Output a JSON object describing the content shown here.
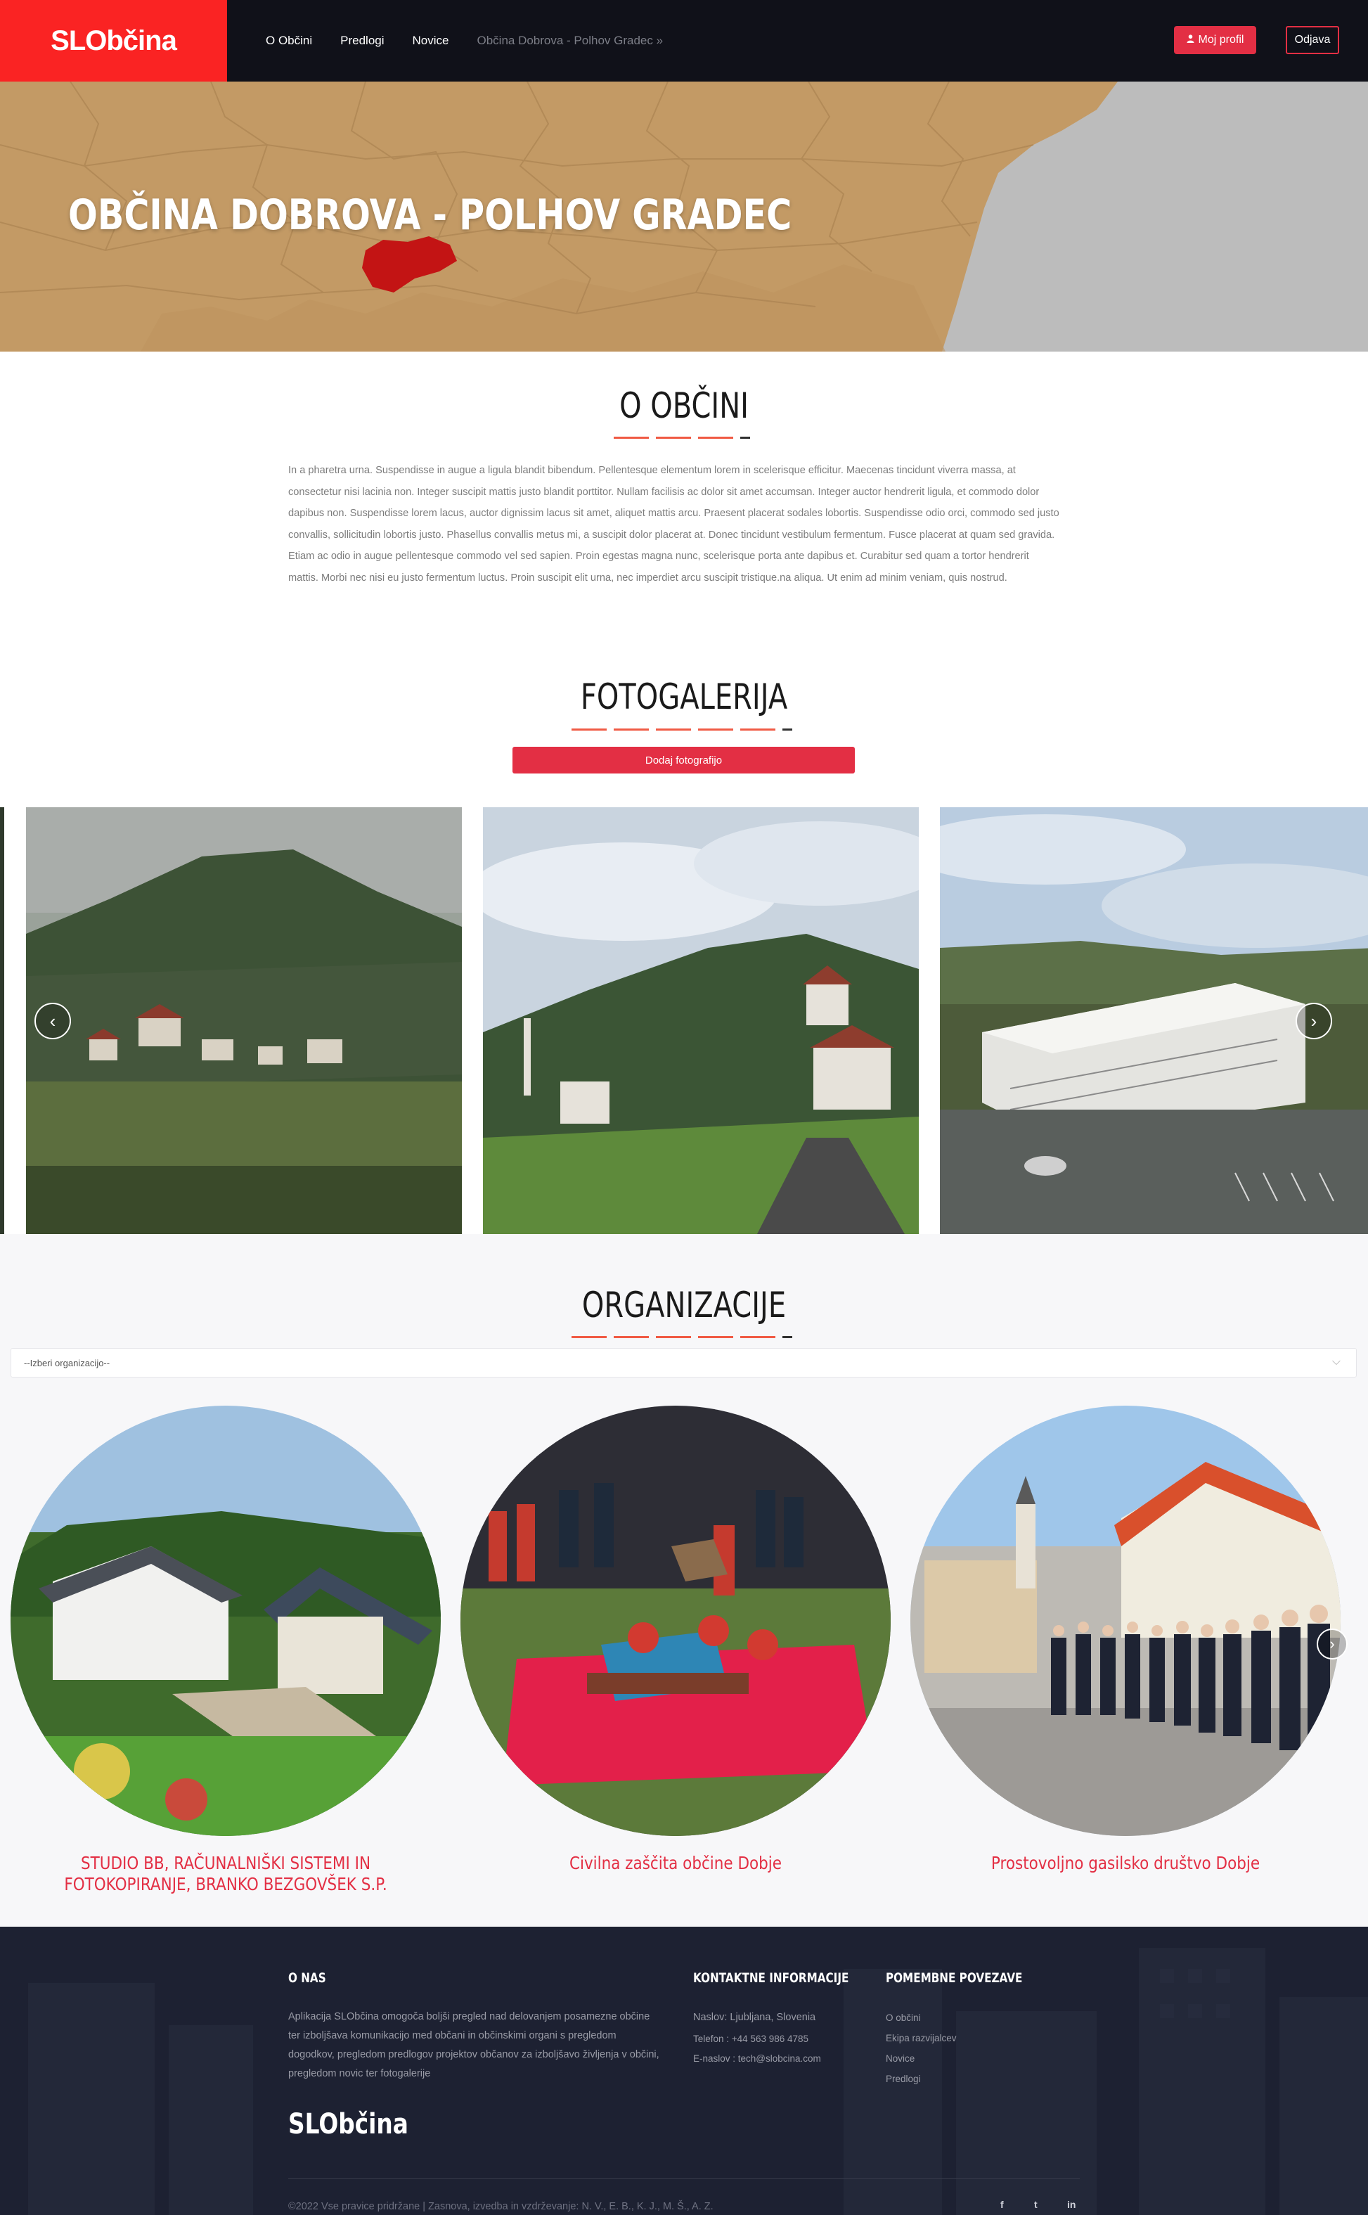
{
  "nav": {
    "brand": "SLObčina",
    "links": [
      "O Občini",
      "Predlogi",
      "Novice"
    ],
    "breadcrumb": "Občina Dobrova - Polhov Gradec »",
    "profile_label": "Moj profil",
    "logout_label": "Odjava"
  },
  "hero": {
    "title": "OBČINA DOBROVA - POLHOV GRADEC"
  },
  "about": {
    "title": "O OBČINI",
    "text": "In a pharetra urna. Suspendisse in augue a ligula blandit bibendum. Pellentesque elementum lorem in scelerisque efficitur. Maecenas tincidunt viverra massa, at consectetur nisi lacinia non. Integer suscipit mattis justo blandit porttitor. Nullam facilisis ac dolor sit amet accumsan. Integer auctor hendrerit ligula, et commodo dolor dapibus non. Suspendisse lorem lacus, auctor dignissim lacus sit amet, aliquet mattis arcu. Praesent placerat sodales lobortis. Suspendisse odio orci, commodo sed justo convallis, sollicitudin lobortis justo. Phasellus convallis metus mi, a suscipit dolor placerat at. Donec tincidunt vestibulum fermentum. Fusce placerat at quam sed gravida. Etiam ac odio in augue pellentesque commodo vel sed sapien. Proin egestas magna nunc, scelerisque porta ante dapibus et. Curabitur sed quam a tortor hendrerit mattis. Morbi nec nisi eu justo fermentum luctus. Proin suscipit elit urna, nec imperdiet arcu suscipit tristique.na aliqua. Ut enim ad minim veniam, quis nostrud."
  },
  "gallery": {
    "title": "FOTOGALERIJA",
    "add_button": "Dodaj fotografijo",
    "prev_icon": "‹",
    "next_icon": "›"
  },
  "organizations": {
    "title": "ORGANIZACIJE",
    "select_value": "--Izberi organizacijo--",
    "items": [
      {
        "name": "STUDIO BB, RAČUNALNIŠKI SISTEMI IN FOTOKOPIRANJE, BRANKO BEZGOVŠEK S.P."
      },
      {
        "name": "Civilna zaščita občine Dobje"
      },
      {
        "name": "Prostovoljno gasilsko društvo Dobje"
      }
    ]
  },
  "footer": {
    "about_title": "O NAS",
    "about_text": "Aplikacija SLObčina omogoča boljši pregled nad delovanjem posamezne občine ter izboljšava komunikacijo med občani in občinskimi organi s pregledom dogodkov, pregledom predlogov projektov občanov za izboljšavo življenja v občini, pregledom novic ter fotogalerije",
    "contact_title": "KONTAKTNE INFORMACIJE",
    "contact_address": "Naslov: Ljubljana, Slovenia",
    "contact_phone": "Telefon : +44 563 986 4785",
    "contact_email": "E-naslov : tech@slobcina.com",
    "links_title": "POMEMBNE POVEZAVE",
    "links": [
      "O občini",
      "Ekipa razvijalcev",
      "Novice",
      "Predlogi"
    ],
    "brand": "SLObčina",
    "copyright": "©2022 Vse pravice pridržane | Zasnova, izvedba in vzdrževanje: N. V., E. B., K. J., M. Š., A. Z.",
    "social": [
      "f",
      "t",
      "in"
    ]
  },
  "colors": {
    "accent": "#e32f44",
    "brand_red": "#fa2323",
    "nav_bg": "#101119",
    "footer_bg": "#1c2030"
  }
}
